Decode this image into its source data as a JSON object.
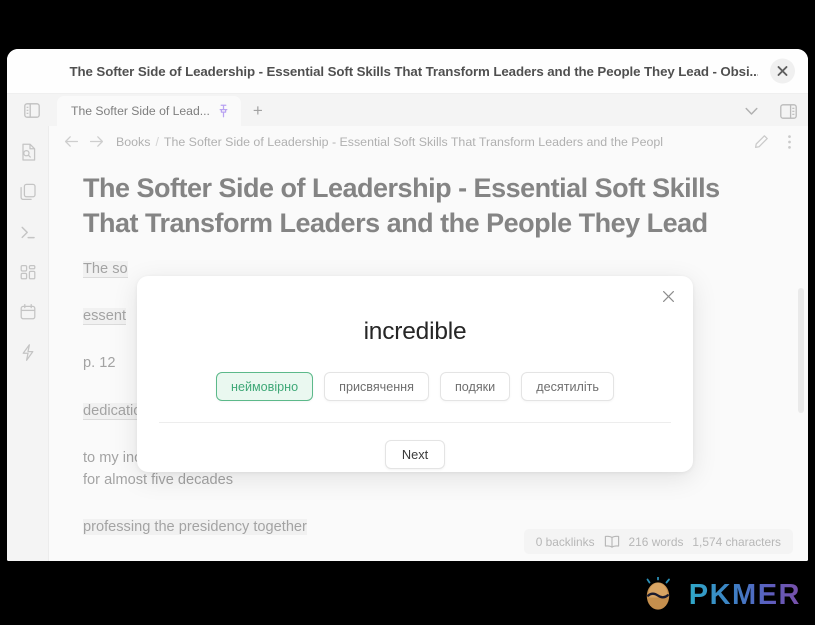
{
  "window": {
    "title": "The Softer Side of Leadership - Essential Soft Skills That Transform Leaders and the People They Lead - Obsi...",
    "close_label": "×"
  },
  "tabbar": {
    "left_toggle_name": "toggle-left-sidebar",
    "tab_label": "The Softer Side of Lead...",
    "pin_name": "pin-icon",
    "new_tab_label": "+",
    "chevron_name": "chevron-down-icon",
    "right_toggle_name": "toggle-right-sidebar"
  },
  "ribbon": {
    "items": [
      {
        "name": "file-search-icon",
        "label": "Search file"
      },
      {
        "name": "copy-files-icon",
        "label": "Files"
      },
      {
        "name": "terminal-icon",
        "label": "Terminal"
      },
      {
        "name": "grid-apps-icon",
        "label": "Apps"
      },
      {
        "name": "calendar-icon",
        "label": "Calendar"
      },
      {
        "name": "lightning-icon",
        "label": "Quick action"
      }
    ]
  },
  "breadcrumb": {
    "back_label": "Back",
    "forward_label": "Forward",
    "root": "Books",
    "separator": "/",
    "leaf": "The Softer Side of Leadership - Essential Soft Skills That Transform Leaders and the Peopl",
    "edit_name": "pencil-icon",
    "more_name": "more-vertical-icon"
  },
  "note": {
    "title": "The Softer Side of Leadership - Essential Soft Skills That Transform Leaders and the People They Lead",
    "paragraphs": [
      {
        "id": "p1",
        "text": "The so"
      },
      {
        "id": "p2",
        "text": "essent"
      },
      {
        "id": "p3",
        "text": "p. 12"
      },
      {
        "id": "p4",
        "text": "dedication and acknowledgments"
      },
      {
        "id": "p5a",
        "text": "to my incredible and loving wife"
      },
      {
        "id": "p5b",
        "text": "for almost five decades"
      },
      {
        "id": "p6",
        "text": "professing the presidency together"
      }
    ]
  },
  "status": {
    "backlinks": "0 backlinks",
    "book_icon": "book-icon",
    "words": "216 words",
    "characters": "1,574 characters"
  },
  "modal": {
    "close_label": "×",
    "word": "incredible",
    "options": [
      {
        "label": "неймовірно",
        "selected": true
      },
      {
        "label": "присвячення",
        "selected": false
      },
      {
        "label": "подяки",
        "selected": false
      },
      {
        "label": "десятиліть",
        "selected": false
      }
    ],
    "next_label": "Next"
  },
  "watermark": {
    "text": "PKMER",
    "logo_name": "pkmer-egg-logo"
  },
  "colors": {
    "accent_green_bg": "#eaf8f0",
    "accent_green_border": "#5cb98a",
    "accent_green_text": "#3fa877",
    "pin_purple": "#a78bf0",
    "window_bg": "#ffffff",
    "pane_bg": "#fafafa",
    "chrome_bg": "#f2f2f2"
  }
}
